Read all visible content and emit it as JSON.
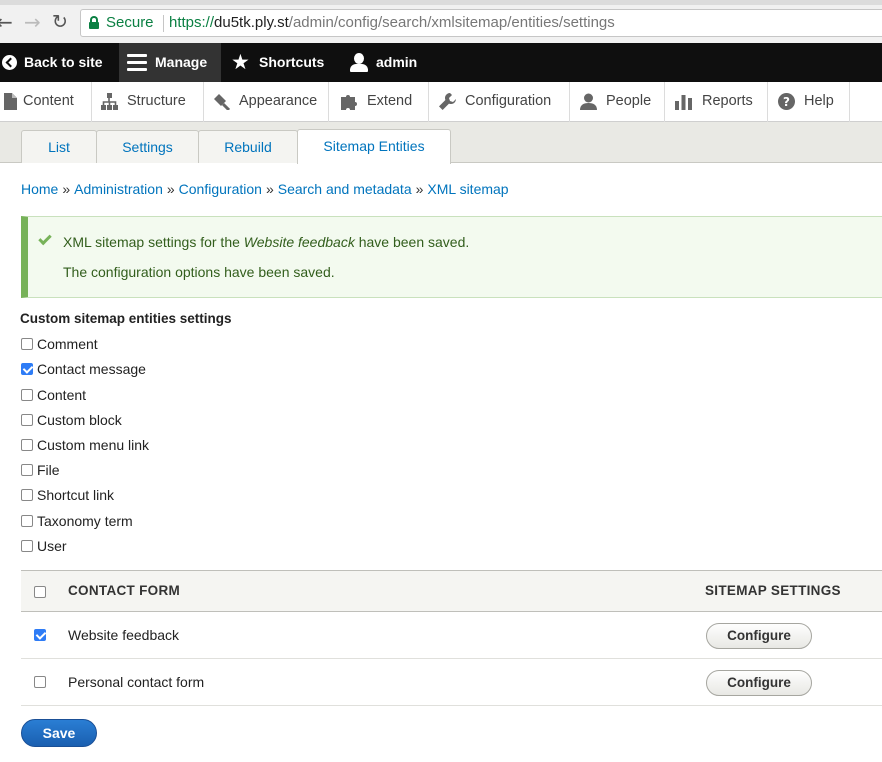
{
  "browser": {
    "secure_label": "Secure",
    "url_scheme": "https://",
    "url_host": "du5tk.ply.st",
    "url_path": "/admin/config/search/xmlsitemap/entities/settings"
  },
  "toolbar": {
    "back_label": "Back to site",
    "manage_label": "Manage",
    "shortcuts_label": "Shortcuts",
    "user_label": "admin"
  },
  "admin_menu": {
    "items": [
      {
        "label": "Content",
        "icon": "file-icon"
      },
      {
        "label": "Structure",
        "icon": "sitemap-icon"
      },
      {
        "label": "Appearance",
        "icon": "paintbrush-icon"
      },
      {
        "label": "Extend",
        "icon": "puzzle-icon"
      },
      {
        "label": "Configuration",
        "icon": "wrench-icon"
      },
      {
        "label": "People",
        "icon": "person-icon"
      },
      {
        "label": "Reports",
        "icon": "bar-chart-icon"
      },
      {
        "label": "Help",
        "icon": "question-icon"
      }
    ]
  },
  "tabs": [
    {
      "label": "List"
    },
    {
      "label": "Settings"
    },
    {
      "label": "Rebuild"
    },
    {
      "label": "Sitemap Entities",
      "active": true
    }
  ],
  "breadcrumb": [
    "Home",
    "Administration",
    "Configuration",
    "Search and metadata",
    "XML sitemap"
  ],
  "breadcrumb_separator": "»",
  "status": {
    "line1_prefix": "XML sitemap settings for the ",
    "line1_emphasis": "Website feedback",
    "line1_suffix": " have been saved.",
    "line2": "The configuration options have been saved."
  },
  "entities": {
    "heading": "Custom sitemap entities settings",
    "options": [
      {
        "label": "Comment",
        "checked": false
      },
      {
        "label": "Contact message",
        "checked": true
      },
      {
        "label": "Content",
        "checked": false
      },
      {
        "label": "Custom block",
        "checked": false
      },
      {
        "label": "Custom menu link",
        "checked": false
      },
      {
        "label": "File",
        "checked": false
      },
      {
        "label": "Shortcut link",
        "checked": false
      },
      {
        "label": "Taxonomy term",
        "checked": false
      },
      {
        "label": "User",
        "checked": false
      }
    ]
  },
  "table": {
    "col_form": "CONTACT FORM",
    "col_settings": "SITEMAP SETTINGS",
    "rows": [
      {
        "name": "Website feedback",
        "checked": true,
        "button": "Configure"
      },
      {
        "name": "Personal contact form",
        "checked": false,
        "button": "Configure"
      }
    ]
  },
  "save_label": "Save",
  "colors": {
    "link": "#0074bd",
    "status_border": "#77b259",
    "primary_button": "#1a5fb0"
  }
}
